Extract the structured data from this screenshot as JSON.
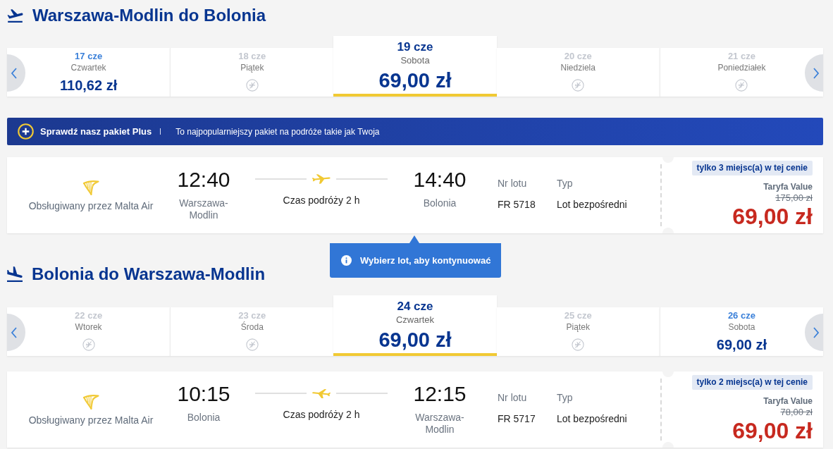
{
  "journeys": [
    {
      "kind": "outbound",
      "title": "Warszawa-Modlin do Bolonia",
      "dates": [
        {
          "date": "17 cze",
          "day": "Czwartek",
          "available": true,
          "price": "110,62 zł",
          "selected": false
        },
        {
          "date": "18 cze",
          "day": "Piątek",
          "available": false,
          "selected": false
        },
        {
          "date": "19 cze",
          "day": "Sobota",
          "available": true,
          "price": "69,00 zł",
          "selected": true
        },
        {
          "date": "20 cze",
          "day": "Niedziela",
          "available": false,
          "selected": false
        },
        {
          "date": "21 cze",
          "day": "Poniedziałek",
          "available": false,
          "selected": false
        }
      ],
      "promo": {
        "title": "Sprawdź nasz pakiet Plus",
        "text": "To najpopularniejszy pakiet na podróże takie jak Twoja"
      },
      "flight": {
        "operator": "Obsługiwany przez Malta Air",
        "departure_time": "12:40",
        "departure_airport": "Warszawa-Modlin",
        "duration": "Czas podróży 2 h",
        "arrival_time": "14:40",
        "arrival_airport": "Bolonia",
        "flight_number_label": "Nr lotu",
        "flight_number": "FR 5718",
        "type_label": "Typ",
        "type": "Lot bezpośredni",
        "seats_badge": "tylko 3 miejsc(a) w tej cenie",
        "fare": "Taryfa Value",
        "old_price": "175,00 zł",
        "price": "69,00 zł"
      },
      "tooltip": {
        "text": "Wybierz lot, aby kontynuować"
      }
    },
    {
      "kind": "inbound",
      "title": "Bolonia do Warszawa-Modlin",
      "dates": [
        {
          "date": "22 cze",
          "day": "Wtorek",
          "available": false,
          "selected": false
        },
        {
          "date": "23 cze",
          "day": "Środa",
          "available": false,
          "selected": false
        },
        {
          "date": "24 cze",
          "day": "Czwartek",
          "available": true,
          "price": "69,00 zł",
          "selected": true
        },
        {
          "date": "25 cze",
          "day": "Piątek",
          "available": false,
          "selected": false
        },
        {
          "date": "26 cze",
          "day": "Sobota",
          "available": true,
          "price": "69,00 zł",
          "selected": false
        }
      ],
      "flight": {
        "operator": "Obsługiwany przez Malta Air",
        "departure_time": "10:15",
        "departure_airport": "Bolonia",
        "duration": "Czas podróży 2 h",
        "arrival_time": "12:15",
        "arrival_airport": "Warszawa-Modlin",
        "flight_number_label": "Nr lotu",
        "flight_number": "FR 5717",
        "type_label": "Typ",
        "type": "Lot bezpośredni",
        "seats_badge": "tylko 2 miejsc(a) w tej cenie",
        "fare": "Taryfa Value",
        "old_price": "78,00 zł",
        "price": "69,00 zł"
      }
    }
  ]
}
